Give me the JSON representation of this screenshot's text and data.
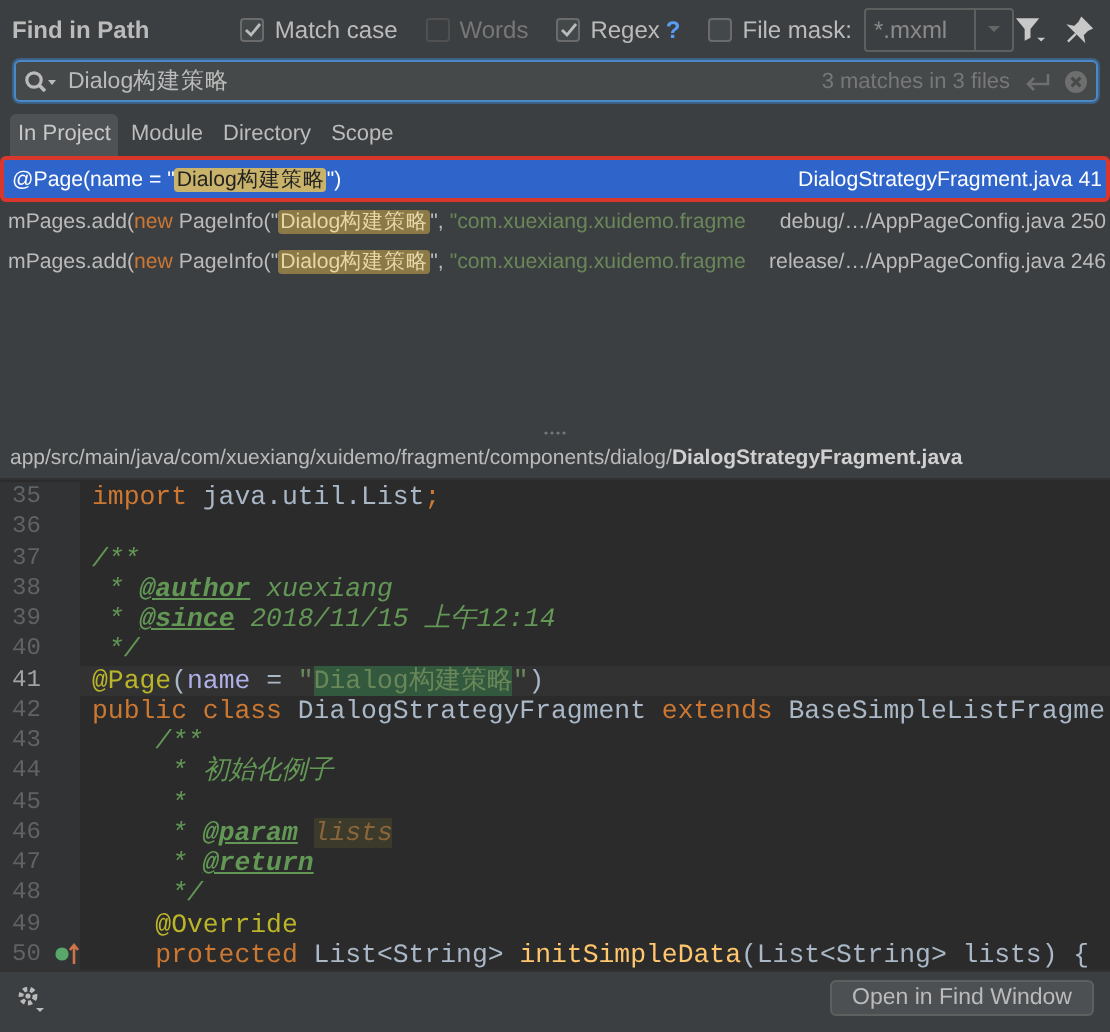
{
  "header": {
    "title": "Find in Path",
    "options": [
      {
        "label": "Match case",
        "checked": true,
        "disabled": false
      },
      {
        "label": "Words",
        "checked": false,
        "disabled": true
      },
      {
        "label": "Regex",
        "checked": true,
        "disabled": false,
        "help": "?"
      },
      {
        "label": "File mask:",
        "checked": false,
        "disabled": false
      }
    ],
    "file_mask": {
      "value": "*.mxml"
    }
  },
  "search": {
    "value": "Dialog构建策略",
    "summary": "3 matches in 3 files"
  },
  "scopes": [
    {
      "label": "In Project",
      "selected": true
    },
    {
      "label": "Module",
      "selected": false
    },
    {
      "label": "Directory",
      "selected": false
    },
    {
      "label": "Scope",
      "selected": false
    }
  ],
  "results": [
    {
      "selected": true,
      "tokens": [
        {
          "kind": "plain",
          "text": "@Page(name = \""
        },
        {
          "kind": "match",
          "text": "Dialog构建策略"
        },
        {
          "kind": "plain",
          "text": "\")"
        }
      ],
      "location": "DialogStrategyFragment.java",
      "line": "41"
    },
    {
      "selected": false,
      "tokens": [
        {
          "kind": "plain",
          "text": "mPages.add("
        },
        {
          "kind": "kw",
          "text": "new"
        },
        {
          "kind": "plain",
          "text": " PageInfo(\""
        },
        {
          "kind": "match",
          "text": "Dialog构建策略"
        },
        {
          "kind": "plain",
          "text": "\", "
        },
        {
          "kind": "string",
          "text": "\"com.xuexiang.xuidemo.fragme"
        }
      ],
      "location": "debug/…/AppPageConfig.java",
      "line": "250"
    },
    {
      "selected": false,
      "tokens": [
        {
          "kind": "plain",
          "text": "mPages.add("
        },
        {
          "kind": "kw",
          "text": "new"
        },
        {
          "kind": "plain",
          "text": " PageInfo(\""
        },
        {
          "kind": "match",
          "text": "Dialog构建策略"
        },
        {
          "kind": "plain",
          "text": "\", "
        },
        {
          "kind": "string",
          "text": "\"com.xuexiang.xuidemo.fragme"
        }
      ],
      "location": "release/…/AppPageConfig.java",
      "line": "246"
    }
  ],
  "editor": {
    "path": "app/src/main/java/com/xuexiang/xuidemo/fragment/components/dialog/",
    "file": "DialogStrategyFragment.java",
    "lines": [
      {
        "number": "35",
        "current": false,
        "override_marker": false,
        "tokens": [
          {
            "kind": "kw",
            "text": "import"
          },
          {
            "kind": "plain",
            "text": " java.util.List"
          },
          {
            "kind": "kw",
            "text": ";"
          }
        ]
      },
      {
        "number": "36",
        "current": false
      },
      {
        "number": "37",
        "current": false,
        "override_marker": false,
        "tokens": [
          {
            "kind": "comment",
            "text": "/**"
          }
        ]
      },
      {
        "number": "38",
        "current": false,
        "override_marker": false,
        "tokens": [
          {
            "kind": "comment",
            "text": " * "
          },
          {
            "kind": "doctag",
            "text": "@author"
          },
          {
            "kind": "comment",
            "text": " xuexiang"
          }
        ]
      },
      {
        "number": "39",
        "current": false,
        "override_marker": false,
        "tokens": [
          {
            "kind": "comment",
            "text": " * "
          },
          {
            "kind": "doctag",
            "text": "@since"
          },
          {
            "kind": "comment",
            "text": " 2018/11/15 上午12:14"
          }
        ]
      },
      {
        "number": "40",
        "current": false,
        "override_marker": false,
        "tokens": [
          {
            "kind": "comment",
            "text": " */"
          }
        ]
      },
      {
        "number": "41",
        "current": true,
        "override_marker": false,
        "tokens": [
          {
            "kind": "annot",
            "text": "@Page"
          },
          {
            "kind": "plain",
            "text": "("
          },
          {
            "kind": "param",
            "text": "name"
          },
          {
            "kind": "plain",
            "text": " = "
          },
          {
            "kind": "string",
            "text": "\""
          },
          {
            "kind": "match",
            "text": "Dialog构建策略"
          },
          {
            "kind": "string",
            "text": "\""
          },
          {
            "kind": "plain",
            "text": ")"
          }
        ]
      },
      {
        "number": "42",
        "current": false,
        "override_marker": false,
        "tokens": [
          {
            "kind": "kw",
            "text": "public class"
          },
          {
            "kind": "plain",
            "text": " DialogStrategyFragment "
          },
          {
            "kind": "kw",
            "text": "extends"
          },
          {
            "kind": "plain",
            "text": " BaseSimpleListFragme"
          }
        ]
      },
      {
        "number": "43",
        "current": false,
        "override_marker": false,
        "tokens": [
          {
            "kind": "comment",
            "text": "    /**"
          }
        ]
      },
      {
        "number": "44",
        "current": false,
        "override_marker": false,
        "tokens": [
          {
            "kind": "comment",
            "text": "     * 初始化例子"
          }
        ]
      },
      {
        "number": "45",
        "current": false,
        "override_marker": false,
        "tokens": [
          {
            "kind": "comment",
            "text": "     *"
          }
        ]
      },
      {
        "number": "46",
        "current": false,
        "override_marker": false,
        "tokens": [
          {
            "kind": "comment",
            "text": "     * "
          },
          {
            "kind": "doctag",
            "text": "@param"
          },
          {
            "kind": "docref",
            "text": "lists"
          }
        ]
      },
      {
        "number": "47",
        "current": false,
        "override_marker": false,
        "tokens": [
          {
            "kind": "comment",
            "text": "     * "
          },
          {
            "kind": "doctag",
            "text": "@return"
          }
        ]
      },
      {
        "number": "48",
        "current": false,
        "override_marker": false,
        "tokens": [
          {
            "kind": "comment",
            "text": "     */"
          }
        ]
      },
      {
        "number": "49",
        "current": false,
        "override_marker": false,
        "tokens": [
          {
            "kind": "annot",
            "text": "    @Override"
          }
        ]
      },
      {
        "number": "50",
        "current": false,
        "override_marker": true,
        "tokens": [
          {
            "kind": "kw",
            "text": "    protected"
          },
          {
            "kind": "plain",
            "text": " List<String> "
          },
          {
            "kind": "method",
            "text": "initSimpleData"
          },
          {
            "kind": "plain",
            "text": "(List<String> lists) {"
          }
        ]
      }
    ]
  },
  "footer": {
    "button": "Open in Find Window"
  }
}
